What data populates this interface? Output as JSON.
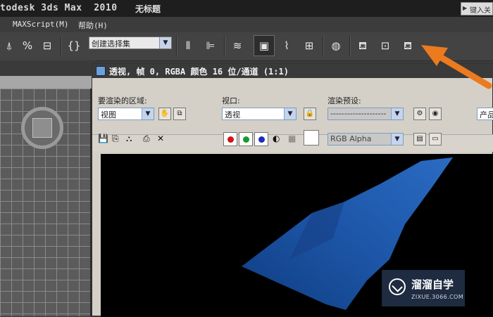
{
  "app": {
    "title": "todesk 3ds Max  2010",
    "document": "无标题",
    "help_search_placeholder": "键入关"
  },
  "menu": {
    "items": [
      "MAXScript(M)",
      "帮助(H)"
    ]
  },
  "toolbar": {
    "selection_set_value": "创建选择集",
    "icons": [
      "select-and-link-icon",
      "percent-snap-icon",
      "spinner-snap-icon",
      "edit-named-selection-icon",
      "mirror-icon",
      "align-icon",
      "layer-manager-icon",
      "render-setup-icon",
      "curve-editor-icon",
      "schematic-view-icon",
      "material-editor-icon",
      "render-frame-window-icon",
      "render-production-icon",
      "quick-render-icon"
    ]
  },
  "rendered_frame_window": {
    "title": "透视, 帧 0, RGBA 颜色 16 位/通道 (1:1)",
    "area_to_render_label": "要渲染的区域:",
    "area_to_render_value": "视图",
    "viewport_label": "视口:",
    "viewport_value": "透视",
    "render_preset_label": "渲染预设:",
    "render_preset_value": "--------------------",
    "production_label": "产品",
    "channel_display_value": "RGB Alpha"
  },
  "watermark": {
    "title": "溜溜自学",
    "subtitle": "ZIXUE.3066.COM"
  },
  "colors": {
    "accent_arrow": "#ec7a1f",
    "render_object": "#1b4f9b",
    "red_channel": "#d41414",
    "green_channel": "#149c2a",
    "blue_channel": "#1d2fb8"
  }
}
